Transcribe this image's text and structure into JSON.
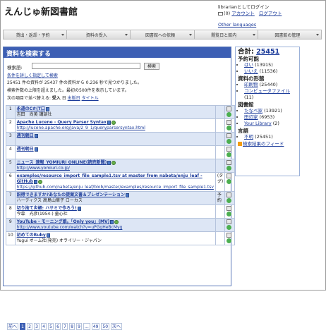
{
  "site": {
    "title": "えんじゅ新図書館"
  },
  "user": {
    "login_text": "librarianとしてログイン",
    "messages": "(0)",
    "account": "アカウント",
    "logout": "ログアウト",
    "other_languages": "Other languages"
  },
  "menu": [
    {
      "label": "貸出・返却・予約"
    },
    {
      "label": "資料の受入"
    },
    {
      "label": "図書館への依頼"
    },
    {
      "label": "閲覧日と館内"
    },
    {
      "label": "図書館の管理"
    }
  ],
  "main": {
    "header": "資料を検索する",
    "search_label": "検索語:",
    "search_value": "",
    "search_button": "検索",
    "advanced_link": "条件を詳しく指定して検索",
    "stats1": "25451 件の資料が 25437 件の資料から 0.236 秒で見つかりました。",
    "stats2": "検索件数の上限を超えました。最初の500件を表示しています。",
    "sort_prefix": "次の項目で並べ替える:",
    "sort_options": [
      "受入",
      "日",
      "出版日",
      "タイトル"
    ]
  },
  "results": [
    {
      "num": "1",
      "title": "永遠のC#(T口",
      "sub": "吉田　尚美 講談社",
      "url": "",
      "book": true,
      "globe": false,
      "mid": ""
    },
    {
      "num": "2",
      "title": "Apache Lucene - Query Parser Syntax",
      "sub": "",
      "url": "http://lucene.apache.org/java/2_9_1/queryparsersyntax.html",
      "book": true,
      "globe": true,
      "mid": ""
    },
    {
      "num": "3",
      "title": "週刊朝日",
      "sub": "",
      "url": "",
      "book": true,
      "globe": false,
      "mid": ""
    },
    {
      "num": "4",
      "title": "週刊朝日",
      "sub": "",
      "url": "",
      "book": true,
      "globe": false,
      "mid": ""
    },
    {
      "num": "5",
      "title": "ニュース_速報_YOMIURI ONLINE(読売新聞)",
      "sub": "",
      "url": "http://www.yomiuri.co.jp/",
      "book": true,
      "globe": true,
      "mid": ""
    },
    {
      "num": "6",
      "title": "examples/resource_import_file_sample1.tsv at master from nabeta/enju_leaf - GitHub",
      "sub": "",
      "url": "https://github.com/nabeta/enju_leaf/blob/master/examples/resource_import_file_sample1.tsv",
      "book": true,
      "globe": true,
      "mid": "(タグ)"
    },
    {
      "num": "7",
      "title": "説得できますか?あなたの提案文書＆プレゼンテーション",
      "sub": "ハーディクス 高島山華子 ローカス",
      "url": "",
      "book": true,
      "globe": false,
      "mid": "予約"
    },
    {
      "num": "8",
      "title": "切り捨て炎帳: ハサミで作ろう!",
      "sub": "今森　光彦(1954-) 童心社",
      "url": "",
      "book": true,
      "globe": false,
      "mid": ""
    },
    {
      "num": "9",
      "title": "YouTube - モーニング娘。「Only you」(MV)",
      "sub": "",
      "url": "http://www.youtube.com/watch?v=uPGgHeBcMyg",
      "book": true,
      "globe": true,
      "mid": ""
    },
    {
      "num": "10",
      "title": "初めてのRuby",
      "sub": "Yugui オーム社(発売) オライリー・ジャパン",
      "url": "",
      "book": true,
      "globe": false,
      "mid": ""
    }
  ],
  "pager": [
    "前へ",
    "1",
    "2",
    "3",
    "4",
    "5",
    "6",
    "7",
    "8",
    "9",
    "...",
    "49",
    "50",
    "次へ"
  ],
  "sidebar": {
    "total_label": "合計: ",
    "total_value": "25451",
    "reservable_heading": "予約可能",
    "reservable": [
      {
        "label": "はい",
        "count": "(13915)"
      },
      {
        "label": "いいえ",
        "count": "(11536)"
      }
    ],
    "form_heading": "資料の形態",
    "forms": [
      {
        "label": "印刷物",
        "count": "(25440)"
      },
      {
        "label": "コンピュータファイル",
        "count": "(11)"
      }
    ],
    "library_heading": "図書館",
    "libraries": [
      {
        "label": "たなべ家",
        "count": "(13921)"
      },
      {
        "label": "田辺家",
        "count": "(6953)"
      },
      {
        "label": "Your Library",
        "count": "(2)"
      }
    ],
    "language_heading": "言語",
    "languages": [
      {
        "label": "不明",
        "count": "(25451)"
      }
    ],
    "feed_label": "検索結果のフィード"
  },
  "colors": {
    "header_blue": "#3d5fb4",
    "row_alt": "#dde6f5",
    "link": "#1a3a9a"
  }
}
